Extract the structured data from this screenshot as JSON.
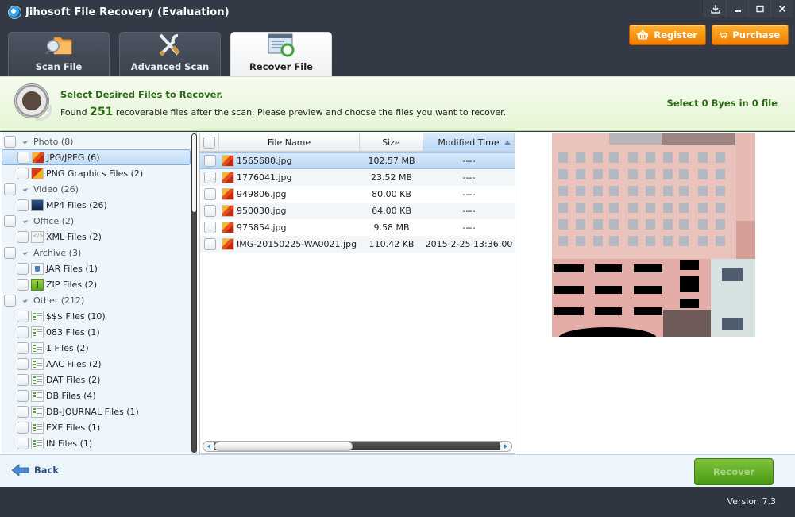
{
  "window": {
    "title": "Jihosoft File Recovery (Evaluation)",
    "controls": [
      "download-icon",
      "minimize-icon",
      "maximize-icon",
      "close-icon"
    ]
  },
  "top_buttons": {
    "register": {
      "label": "Register",
      "icon": "basket-icon"
    },
    "purchase": {
      "label": "Purchase",
      "icon": "cart-icon"
    }
  },
  "tabs": [
    {
      "label": "Scan File",
      "icon": "folder-search-icon",
      "active": false
    },
    {
      "label": "Advanced Scan",
      "icon": "tools-icon",
      "active": false
    },
    {
      "label": "Recover File",
      "icon": "recover-window-icon",
      "active": true
    }
  ],
  "info": {
    "title": "Select Desired Files to Recover.",
    "text_prefix": "Found",
    "count": "251",
    "text_suffix": "recoverable files after the scan. Please preview and choose the files you want to recover.",
    "selection_summary": "Select 0 Byes in 0 file"
  },
  "tree": {
    "rows": [
      {
        "type": "category",
        "label": "Photo (8)"
      },
      {
        "type": "item",
        "label": "JPG/JPEG (6)",
        "icon": "jpg",
        "selected": true
      },
      {
        "type": "item",
        "label": "PNG Graphics Files (2)",
        "icon": "png"
      },
      {
        "type": "category",
        "label": "Video (26)"
      },
      {
        "type": "item",
        "label": "MP4 Files (26)",
        "icon": "mp4"
      },
      {
        "type": "category",
        "label": "Office (2)"
      },
      {
        "type": "item",
        "label": "XML Files (2)",
        "icon": "xml"
      },
      {
        "type": "category",
        "label": "Archive (3)"
      },
      {
        "type": "item",
        "label": "JAR Files (1)",
        "icon": "jar"
      },
      {
        "type": "item",
        "label": "ZIP Files (2)",
        "icon": "zip"
      },
      {
        "type": "category",
        "label": "Other (212)"
      },
      {
        "type": "item",
        "label": "$$$ Files (10)",
        "icon": "doc"
      },
      {
        "type": "item",
        "label": "083 Files (1)",
        "icon": "doc"
      },
      {
        "type": "item",
        "label": "1 Files (2)",
        "icon": "doc"
      },
      {
        "type": "item",
        "label": "AAC Files (2)",
        "icon": "doc"
      },
      {
        "type": "item",
        "label": "DAT Files (2)",
        "icon": "doc"
      },
      {
        "type": "item",
        "label": "DB Files (4)",
        "icon": "doc"
      },
      {
        "type": "item",
        "label": "DB-JOURNAL Files (1)",
        "icon": "doc"
      },
      {
        "type": "item",
        "label": "EXE Files (1)",
        "icon": "doc"
      },
      {
        "type": "item",
        "label": "IN Files (1)",
        "icon": "doc"
      }
    ]
  },
  "file_list": {
    "columns": {
      "name": "File Name",
      "size": "Size",
      "time": "Modified Time"
    },
    "sort_column": "time",
    "rows": [
      {
        "name": "1565680.jpg",
        "size": "102.57 MB",
        "time": "----",
        "selected": true
      },
      {
        "name": "1776041.jpg",
        "size": "23.52 MB",
        "time": "----"
      },
      {
        "name": "949806.jpg",
        "size": "80.00 KB",
        "time": "----"
      },
      {
        "name": "950030.jpg",
        "size": "64.00 KB",
        "time": "----"
      },
      {
        "name": "975854.jpg",
        "size": "9.58 MB",
        "time": "----"
      },
      {
        "name": "IMG-20150225-WA0021.jpg",
        "size": "110.42 KB",
        "time": "2015-2-25 13:36:00"
      }
    ]
  },
  "preview": {
    "subject": "pink building facade texture"
  },
  "footer": {
    "back_label": "Back",
    "recover_label": "Recover"
  },
  "status": {
    "version": "Version 7.3"
  }
}
